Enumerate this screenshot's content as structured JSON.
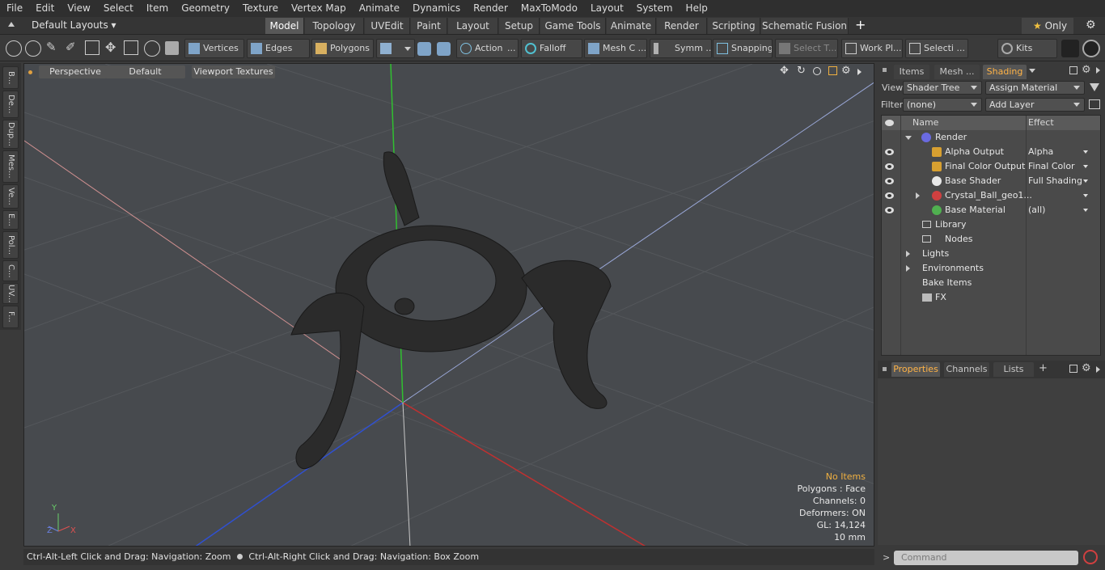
{
  "menu": [
    "File",
    "Edit",
    "View",
    "Select",
    "Item",
    "Geometry",
    "Texture",
    "Vertex Map",
    "Animate",
    "Dynamics",
    "Render",
    "MaxToModo",
    "Layout",
    "System",
    "Help"
  ],
  "layout": {
    "preset": "Default Layouts",
    "tabs": [
      "Model",
      "Topology",
      "UVEdit",
      "Paint",
      "Layout",
      "Setup",
      "Game Tools",
      "Animate",
      "Render",
      "Scripting",
      "Schematic Fusion"
    ],
    "active_tab": "Model",
    "add": "+",
    "only_label": "Only"
  },
  "toolbar": {
    "vertices": "Vertices",
    "edges": "Edges",
    "polygons": "Polygons",
    "action": "Action",
    "action_more": "...",
    "falloff": "Falloff",
    "mesh": "Mesh C ...",
    "symm": "Symm ...",
    "snapping": "Snapping",
    "select_t": "Select T...",
    "work_pl": "Work Pl...",
    "selecti": "Selecti ...",
    "kits": "Kits"
  },
  "left_tabs": [
    "B...",
    "De...",
    "Dup...",
    "Mes...",
    "Ve...",
    "E...",
    "Pol...",
    "C...",
    "UV...",
    "F..."
  ],
  "viewport": {
    "mode": "Perspective",
    "shading": "Default",
    "textures": "Viewport Textures",
    "info": {
      "items": "No Items",
      "polygons": "Polygons : Face",
      "channels": "Channels: 0",
      "deformers": "Deformers: ON",
      "gl": "GL: 14,124",
      "scale": "10 mm"
    },
    "axis_labels": {
      "y": "Y",
      "x": "X",
      "z": "Z"
    },
    "colors": {
      "background": "#474a4e",
      "x_axis": "#c03030",
      "y_axis": "#30c030",
      "z_axis": "#3050d0",
      "model": "#2b2b2b"
    }
  },
  "status": {
    "hint1": "Ctrl-Alt-Left Click and Drag: Navigation: Zoom",
    "hint2": "Ctrl-Alt-Right Click and Drag: Navigation: Box Zoom"
  },
  "right_panel": {
    "tabs": [
      "Items",
      "Mesh ...",
      "Shading"
    ],
    "active_tab": "Shading",
    "view_label": "View",
    "view_value": "Shader Tree",
    "assign": "Assign Material",
    "filter_label": "Filter",
    "filter_value": "(none)",
    "add_layer": "Add Layer",
    "columns": {
      "name": "Name",
      "effect": "Effect"
    },
    "rows": [
      {
        "name": "Render",
        "effect": "",
        "eye": false,
        "color": "#6a6ae0"
      },
      {
        "name": "Alpha Output",
        "effect": "Alpha",
        "eye": true,
        "color": "#d8a030"
      },
      {
        "name": "Final Color Output",
        "effect": "Final Color",
        "eye": true,
        "color": "#d8a030"
      },
      {
        "name": "Base Shader",
        "effect": "Full Shading",
        "eye": true,
        "color": "#e8e8e8"
      },
      {
        "name": "Crystal_Ball_geo1...",
        "effect": "",
        "eye": true,
        "color": "#d04040"
      },
      {
        "name": "Base Material",
        "effect": "(all)",
        "eye": true,
        "color": "#50b050"
      },
      {
        "name": "Library",
        "effect": "",
        "eye": false
      },
      {
        "name": "Nodes",
        "effect": "",
        "eye": false
      },
      {
        "name": "Lights",
        "effect": "",
        "eye": false
      },
      {
        "name": "Environments",
        "effect": "",
        "eye": false
      },
      {
        "name": "Bake Items",
        "effect": "",
        "eye": false
      },
      {
        "name": "FX",
        "effect": "",
        "eye": false
      }
    ],
    "bottom_tabs": [
      "Properties",
      "Channels",
      "Lists"
    ],
    "bottom_active": "Properties",
    "bottom_add": "+",
    "command_placeholder": "Command",
    "prompt": ">"
  }
}
